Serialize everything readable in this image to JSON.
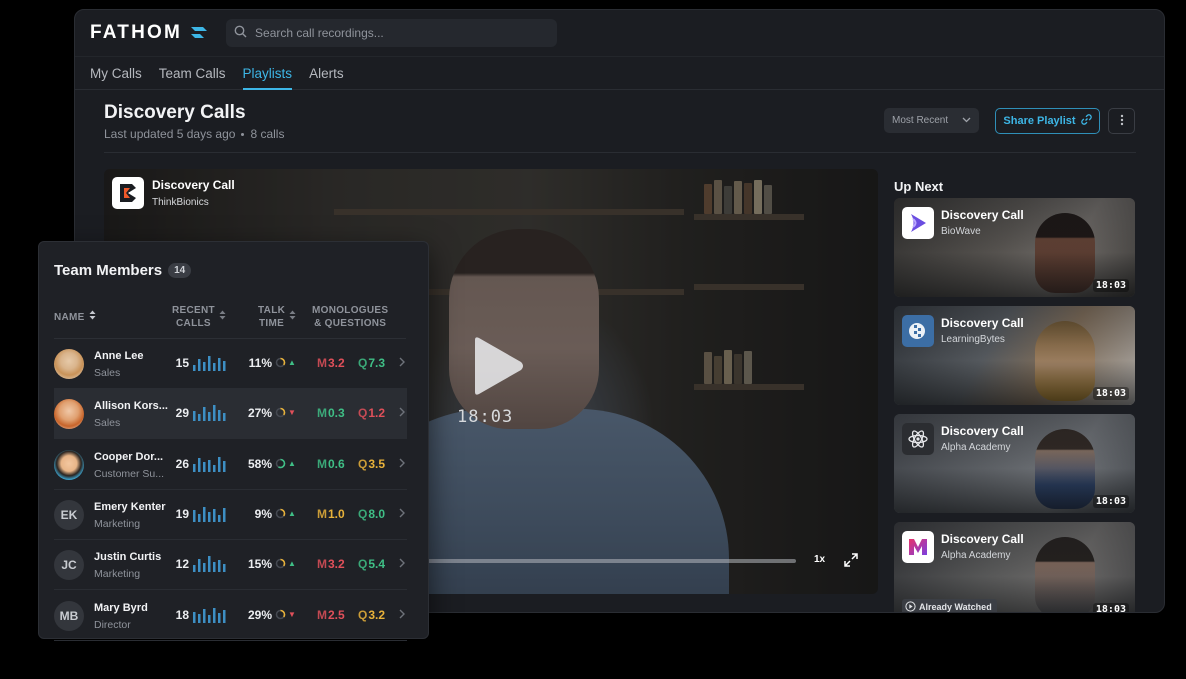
{
  "app": {
    "brand": "FATHOM",
    "search_placeholder": "Search call recordings..."
  },
  "tabs": [
    {
      "label": "My Calls"
    },
    {
      "label": "Team Calls"
    },
    {
      "label": "Playlists",
      "active": true
    },
    {
      "label": "Alerts"
    }
  ],
  "playlist": {
    "title": "Discovery Calls",
    "updated": "Last updated 5 days ago",
    "calls_count": "8 calls",
    "sort_value": "Most Recent",
    "share_label": "Share Playlist"
  },
  "video": {
    "title": "Discovery Call",
    "company": "ThinkBionics",
    "duration": "18:03",
    "speed": "1x"
  },
  "up_next": {
    "heading": "Up Next",
    "items": [
      {
        "title": "Discovery Call",
        "company": "BioWave",
        "duration": "18:03"
      },
      {
        "title": "Discovery Call",
        "company": "LearningBytes",
        "duration": "18:03"
      },
      {
        "title": "Discovery Call",
        "company": "Alpha Academy",
        "duration": "18:03"
      },
      {
        "title": "Discovery Call",
        "company": "Alpha Academy",
        "duration": "18:03",
        "badge": "Already Watched"
      }
    ]
  },
  "team": {
    "title": "Team Members",
    "count": "14",
    "columns": {
      "name": "NAME",
      "recent_calls": [
        "RECENT",
        "CALLS"
      ],
      "talk_time": [
        "TALK",
        "TIME"
      ],
      "mq": [
        "MONOLOGUES",
        "& QUESTIONS"
      ]
    },
    "rows": [
      {
        "name": "Anne Lee",
        "role": "Sales",
        "initials": "",
        "calls": "15",
        "talk": "11%",
        "trend": "up",
        "m": "3.2",
        "q": "7.3",
        "m_color": "#e0505a",
        "q_color": "#3fbf86"
      },
      {
        "name": "Allison Kors...",
        "role": "Sales",
        "initials": "",
        "calls": "29",
        "talk": "27%",
        "trend": "down",
        "m": "0.3",
        "q": "1.2",
        "m_color": "#3fbf86",
        "q_color": "#e0505a"
      },
      {
        "name": "Cooper Dor...",
        "role": "Customer Su...",
        "initials": "",
        "calls": "26",
        "talk": "58%",
        "trend": "up",
        "m": "0.6",
        "q": "3.5",
        "m_color": "#3fbf86",
        "q_color": "#e8b23a"
      },
      {
        "name": "Emery Kenter",
        "role": "Marketing",
        "initials": "EK",
        "calls": "19",
        "talk": "9%",
        "trend": "up",
        "m": "1.0",
        "q": "8.0",
        "m_color": "#e8b23a",
        "q_color": "#3fbf86"
      },
      {
        "name": "Justin Curtis",
        "role": "Marketing",
        "initials": "JC",
        "calls": "12",
        "talk": "15%",
        "trend": "up",
        "m": "3.2",
        "q": "5.4",
        "m_color": "#e0505a",
        "q_color": "#3fbf86"
      },
      {
        "name": "Mary Byrd",
        "role": "Director",
        "initials": "MB",
        "calls": "18",
        "talk": "29%",
        "trend": "down",
        "m": "2.5",
        "q": "3.2",
        "m_color": "#e0505a",
        "q_color": "#e8b23a"
      }
    ]
  },
  "colors": {
    "accent": "#3db6e6",
    "trend_up": "#3fbf86",
    "trend_down": "#e0505a"
  }
}
